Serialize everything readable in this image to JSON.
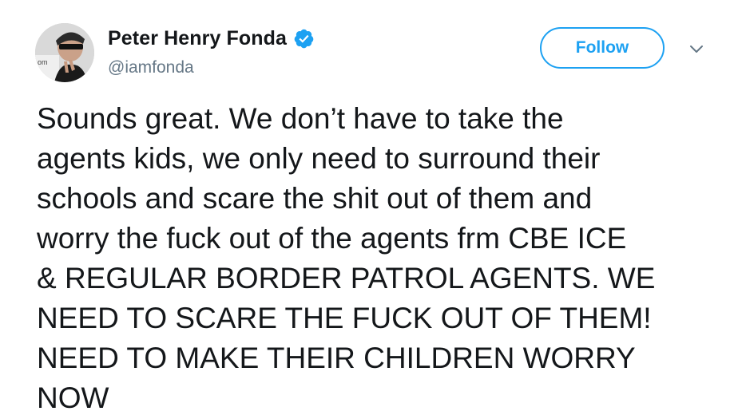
{
  "tweet": {
    "author": {
      "display_name": "Peter Henry Fonda",
      "handle": "@iamfonda",
      "verified": true,
      "avatar": "profile-photo"
    },
    "follow_label": "Follow",
    "menu_icon": "chevron-down-icon",
    "text": "Sounds great. We don’t have to take the\nagents kids, we only need to surround their\nschools and scare the shit out of them and\nworry the fuck out of the agents frm CBE ICE\n& REGULAR BORDER PATROL AGENTS. WE\nNEED TO SCARE THE FUCK OUT OF THEM!\nNEED TO MAKE THEIR CHILDREN WORRY\nNOW"
  },
  "colors": {
    "accent": "#1da1f2",
    "text": "#14171a",
    "secondary_text": "#657786"
  }
}
